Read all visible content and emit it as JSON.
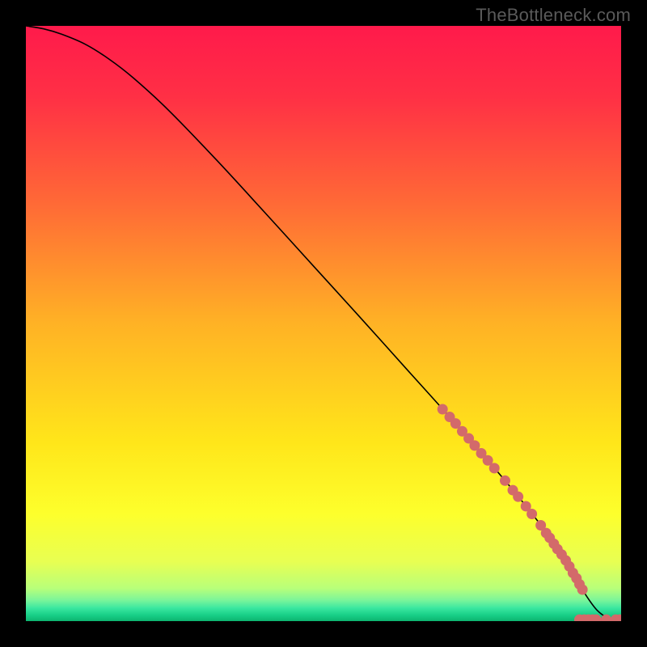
{
  "watermark": "TheBottleneck.com",
  "chart_data": {
    "type": "line",
    "title": "",
    "xlabel": "",
    "ylabel": "",
    "xlim": [
      0,
      100
    ],
    "ylim": [
      0,
      100
    ],
    "background_gradient": {
      "stops": [
        {
          "offset": 0.0,
          "color": "#ff1a4b"
        },
        {
          "offset": 0.12,
          "color": "#ff3045"
        },
        {
          "offset": 0.3,
          "color": "#ff6a36"
        },
        {
          "offset": 0.5,
          "color": "#ffb225"
        },
        {
          "offset": 0.7,
          "color": "#ffe61a"
        },
        {
          "offset": 0.82,
          "color": "#fdff2c"
        },
        {
          "offset": 0.9,
          "color": "#e8ff52"
        },
        {
          "offset": 0.945,
          "color": "#b8ff7a"
        },
        {
          "offset": 0.965,
          "color": "#7af59a"
        },
        {
          "offset": 0.978,
          "color": "#3be7a0"
        },
        {
          "offset": 0.99,
          "color": "#18cf87"
        },
        {
          "offset": 1.0,
          "color": "#0db46f"
        }
      ]
    },
    "series": [
      {
        "name": "curve",
        "x": [
          0.0,
          3.0,
          6.0,
          10.0,
          14.0,
          18.0,
          24.0,
          32.0,
          40.0,
          48.0,
          56.0,
          64.0,
          72.0,
          80.0,
          86.0,
          90.0,
          92.5,
          94.0,
          96.0,
          98.0,
          100.0
        ],
        "y": [
          100.0,
          99.5,
          98.6,
          96.9,
          94.4,
          91.3,
          85.8,
          77.5,
          68.8,
          60.0,
          51.2,
          42.3,
          33.4,
          24.2,
          16.8,
          11.2,
          7.2,
          4.5,
          1.8,
          0.45,
          0.2
        ],
        "stroke": "#000000",
        "stroke_width": 1.6
      }
    ],
    "scatter": [
      {
        "name": "dots",
        "points": [
          {
            "x": 70.0,
            "y": 35.6
          },
          {
            "x": 71.2,
            "y": 34.3
          },
          {
            "x": 72.2,
            "y": 33.2
          },
          {
            "x": 73.3,
            "y": 31.9
          },
          {
            "x": 74.4,
            "y": 30.7
          },
          {
            "x": 75.4,
            "y": 29.5
          },
          {
            "x": 76.5,
            "y": 28.2
          },
          {
            "x": 77.6,
            "y": 27.0
          },
          {
            "x": 78.7,
            "y": 25.7
          },
          {
            "x": 80.5,
            "y": 23.6
          },
          {
            "x": 81.8,
            "y": 22.0
          },
          {
            "x": 82.7,
            "y": 20.9
          },
          {
            "x": 84.0,
            "y": 19.3
          },
          {
            "x": 85.0,
            "y": 18.0
          },
          {
            "x": 86.5,
            "y": 16.1
          },
          {
            "x": 87.4,
            "y": 14.8
          },
          {
            "x": 88.0,
            "y": 14.0
          },
          {
            "x": 88.7,
            "y": 13.0
          },
          {
            "x": 89.3,
            "y": 12.1
          },
          {
            "x": 90.0,
            "y": 11.2
          },
          {
            "x": 90.7,
            "y": 10.2
          },
          {
            "x": 91.3,
            "y": 9.2
          },
          {
            "x": 91.9,
            "y": 8.1
          },
          {
            "x": 92.5,
            "y": 7.2
          },
          {
            "x": 93.0,
            "y": 6.2
          },
          {
            "x": 93.5,
            "y": 5.3
          },
          {
            "x": 93.0,
            "y": 0.25
          },
          {
            "x": 93.8,
            "y": 0.25
          },
          {
            "x": 94.5,
            "y": 0.25
          },
          {
            "x": 95.2,
            "y": 0.25
          },
          {
            "x": 95.8,
            "y": 0.25
          },
          {
            "x": 97.5,
            "y": 0.25
          },
          {
            "x": 99.1,
            "y": 0.25
          },
          {
            "x": 99.8,
            "y": 0.25
          }
        ],
        "fill": "#d36a6a",
        "radius": 6.5
      }
    ]
  }
}
